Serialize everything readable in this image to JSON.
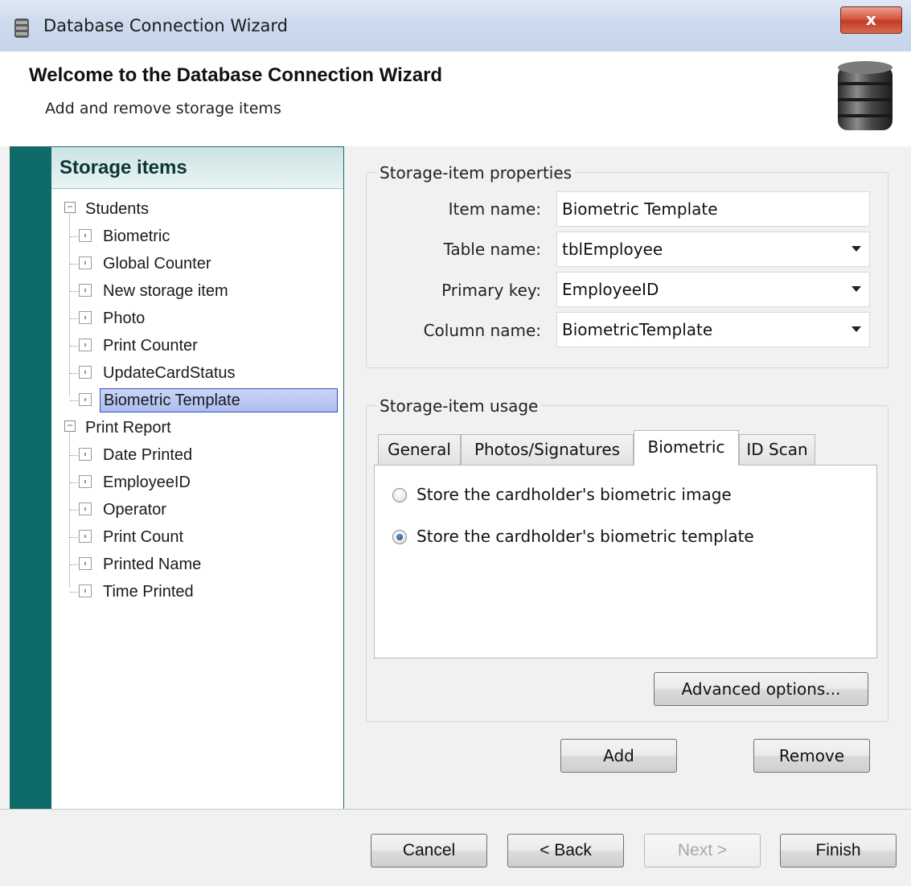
{
  "window": {
    "title": "Database Connection Wizard",
    "close_label": "x"
  },
  "header": {
    "title": "Welcome to the Database Connection Wizard",
    "subtitle": "Add and remove storage items"
  },
  "left_panel": {
    "title": "Storage items",
    "groups": [
      {
        "label": "Students",
        "children": [
          "Biometric",
          "Global Counter",
          "New storage item",
          "Photo",
          "Print Counter",
          "UpdateCardStatus",
          "Biometric Template"
        ]
      },
      {
        "label": "Print Report",
        "children": [
          "Date Printed",
          "EmployeeID",
          "Operator",
          "Print Count",
          "Printed Name",
          "Time Printed"
        ]
      }
    ],
    "selected_item": "Biometric Template"
  },
  "properties": {
    "group_label": "Storage-item properties",
    "item_name_label": "Item name:",
    "item_name_value": "Biometric Template",
    "table_name_label": "Table name:",
    "table_name_value": "tblEmployee",
    "primary_key_label": "Primary key:",
    "primary_key_value": "EmployeeID",
    "column_name_label": "Column name:",
    "column_name_value": "BiometricTemplate"
  },
  "usage": {
    "group_label": "Storage-item usage",
    "tabs": [
      "General",
      "Photos/Signatures",
      "Biometric",
      "ID Scan"
    ],
    "active_tab": "Biometric",
    "options": [
      {
        "label": "Store the cardholder's biometric image",
        "checked": false
      },
      {
        "label": "Store the cardholder's biometric template",
        "checked": true
      }
    ],
    "advanced_button": "Advanced options..."
  },
  "actions": {
    "add": "Add",
    "remove": "Remove"
  },
  "footer": {
    "cancel": "Cancel",
    "back": "< Back",
    "next": "Next >",
    "finish": "Finish"
  },
  "colors": {
    "left_strip": "#0f6b68",
    "selection": "#aebdf0",
    "close_button": "#c43a22"
  }
}
